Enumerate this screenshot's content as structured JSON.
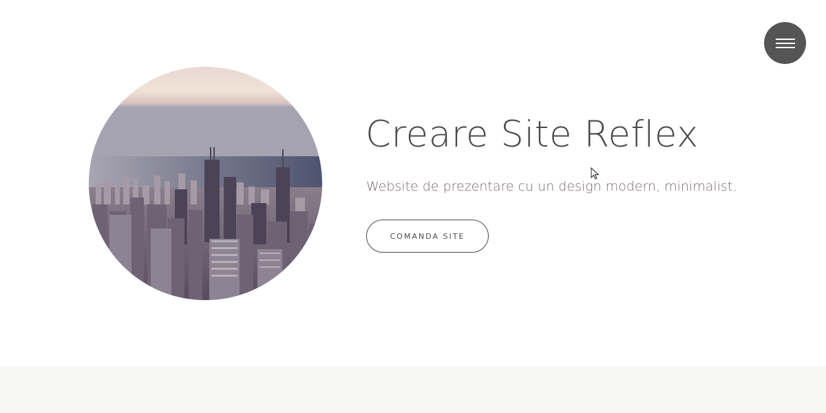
{
  "header": {
    "menu_icon": "hamburger-icon"
  },
  "hero": {
    "image_alt": "city-skyline-image",
    "title": "Creare Site Reflex",
    "subtitle": "Website de prezentare cu un design modern, minimalist.",
    "cta_label": "COMANDA SITE"
  },
  "colors": {
    "menu_button_bg": "#555555",
    "title_text": "#4a4a4a",
    "subtitle_text": "#7a6a6e",
    "lower_band_bg": "#f6f6f4"
  }
}
